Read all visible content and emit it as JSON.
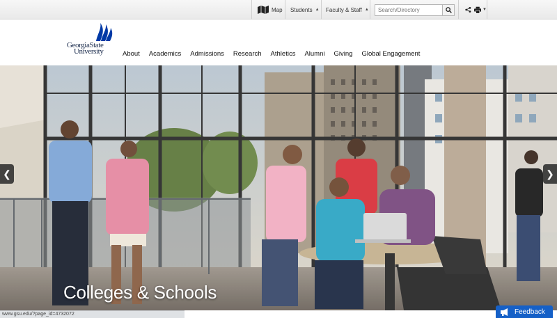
{
  "utility_bar": {
    "map_label": "Map",
    "students_label": "Students",
    "faculty_label": "Faculty & Staff",
    "search_placeholder": "Search/Directory"
  },
  "logo": {
    "line1": "GeorgiaState",
    "line2": "University"
  },
  "nav": {
    "items": [
      "About",
      "Academics",
      "Admissions",
      "Research",
      "Athletics",
      "Alumni",
      "Giving",
      "Global Engagement"
    ]
  },
  "hero": {
    "title": "Colleges & Schools"
  },
  "status": {
    "url": "www.gsu.edu/?page_id=4732072"
  },
  "feedback": {
    "label": "Feedback"
  },
  "colors": {
    "brand_blue": "#0039a6",
    "feedback_bg": "#1560c7"
  }
}
